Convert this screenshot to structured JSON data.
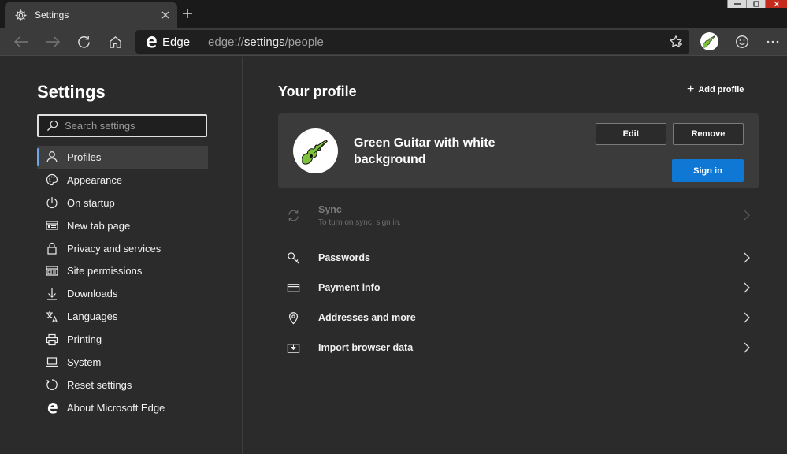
{
  "tab": {
    "title": "Settings"
  },
  "omnibox": {
    "brand": "Edge",
    "url_scheme": "edge://",
    "url_path": "settings",
    "url_rest": "/people"
  },
  "sidebar": {
    "title": "Settings",
    "search_placeholder": "Search settings",
    "items": [
      {
        "label": "Profiles",
        "icon": "person-icon",
        "active": true
      },
      {
        "label": "Appearance",
        "icon": "palette-icon"
      },
      {
        "label": "On startup",
        "icon": "power-icon"
      },
      {
        "label": "New tab page",
        "icon": "newtab-icon"
      },
      {
        "label": "Privacy and services",
        "icon": "lock-icon"
      },
      {
        "label": "Site permissions",
        "icon": "site-permissions-icon"
      },
      {
        "label": "Downloads",
        "icon": "download-icon"
      },
      {
        "label": "Languages",
        "icon": "languages-icon"
      },
      {
        "label": "Printing",
        "icon": "printer-icon"
      },
      {
        "label": "System",
        "icon": "laptop-icon"
      },
      {
        "label": "Reset settings",
        "icon": "reset-icon"
      },
      {
        "label": "About Microsoft Edge",
        "icon": "edge-logo-icon"
      }
    ]
  },
  "main": {
    "title": "Your profile",
    "add_profile": "Add profile",
    "profile": {
      "name": "Green Guitar with white background",
      "edit": "Edit",
      "remove": "Remove",
      "sign_in": "Sign in"
    },
    "sync": {
      "label": "Sync",
      "sub": "To turn on sync, sign in."
    },
    "rows": [
      {
        "label": "Passwords",
        "icon": "key-icon"
      },
      {
        "label": "Payment info",
        "icon": "card-icon"
      },
      {
        "label": "Addresses and more",
        "icon": "location-pin-icon"
      },
      {
        "label": "Import browser data",
        "icon": "import-icon"
      }
    ]
  },
  "colors": {
    "accent": "#0f78d4",
    "active_indicator": "#6ea8e8",
    "guitar": "#7dc23a"
  }
}
